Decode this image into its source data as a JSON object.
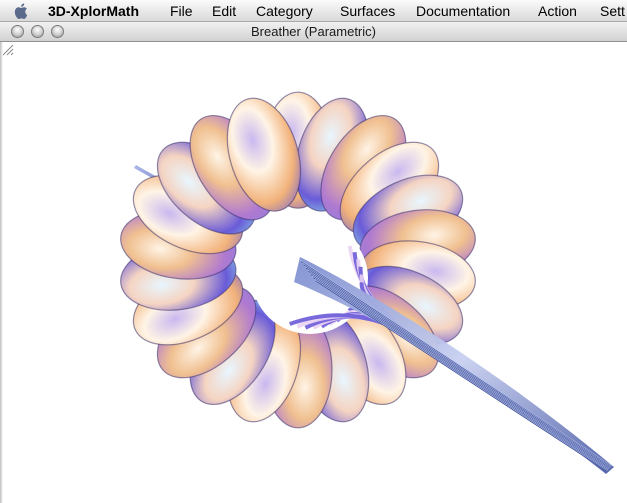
{
  "menubar": {
    "app_name": "3D-XplorMath",
    "items": [
      "File",
      "Edit",
      "Category",
      "Surfaces",
      "Documentation",
      "Action",
      "Sett"
    ]
  },
  "window": {
    "title": "Breather (Parametric)"
  },
  "icons": {
    "apple": "apple-icon",
    "close": "close-button",
    "minimize": "minimize-button",
    "zoom": "zoom-button",
    "resize": "resize-grip-icon"
  },
  "colors": {
    "surface_light": "#fff4e6",
    "surface_orange": "#f2b27a",
    "surface_violet": "#6a5bd8",
    "surface_cyan": "#8fe9e6",
    "stem_blue": "#5a6fb5"
  }
}
